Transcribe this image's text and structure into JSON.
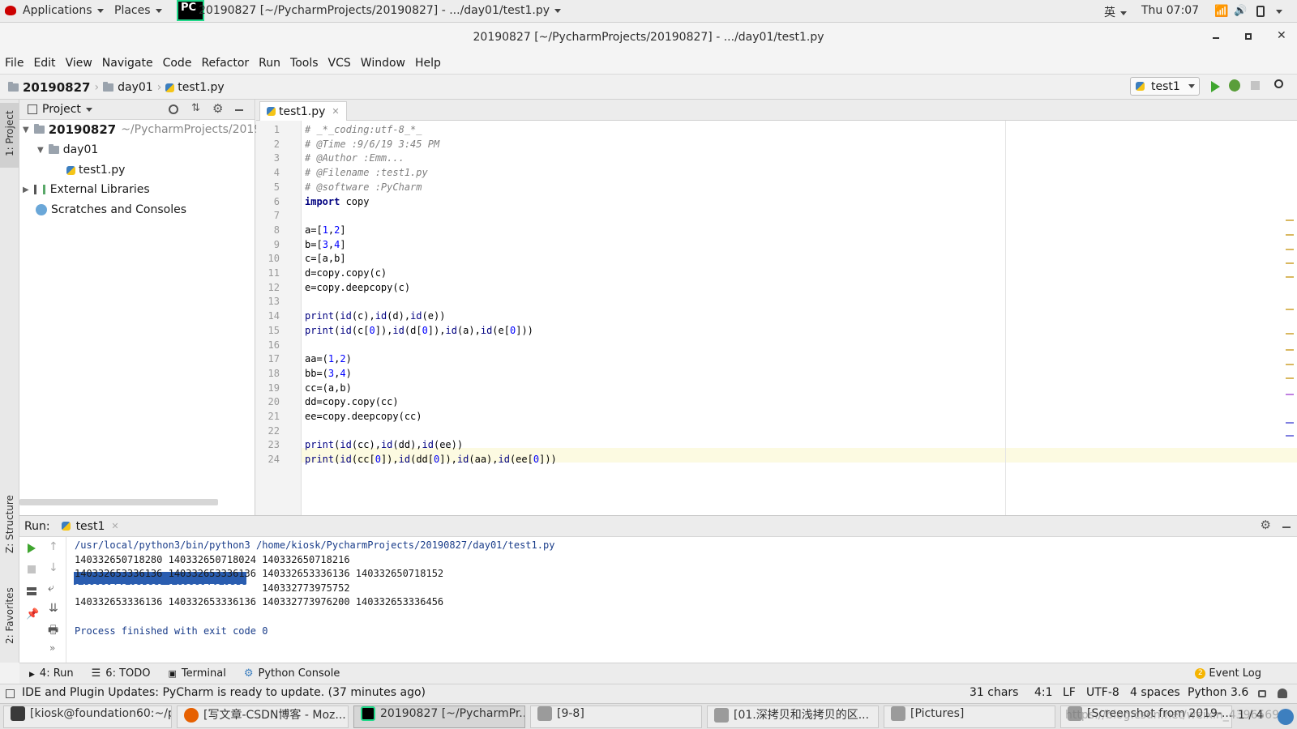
{
  "gnome": {
    "applications": "Applications",
    "places": "Places",
    "window_title": "20190827 [~/PycharmProjects/20190827] - .../day01/test1.py",
    "lang": "英",
    "clock": "Thu 07:07"
  },
  "window": {
    "title": "20190827 [~/PycharmProjects/20190827] - .../day01/test1.py"
  },
  "menu": [
    "File",
    "Edit",
    "View",
    "Navigate",
    "Code",
    "Refactor",
    "Run",
    "Tools",
    "VCS",
    "Window",
    "Help"
  ],
  "breadcrumb": [
    "20190827",
    "day01",
    "test1.py"
  ],
  "run_config": "test1",
  "project": {
    "header": "Project",
    "root": {
      "name": "20190827",
      "path": "~/PycharmProjects/2019"
    },
    "folder": "day01",
    "file": "test1.py",
    "external": "External Libraries",
    "scratches": "Scratches and Consoles"
  },
  "sidebar_tabs": {
    "project": "1: Project",
    "structure": "Z: Structure",
    "favorites": "2: Favorites"
  },
  "editor": {
    "tab": "test1.py",
    "lines": [
      "# _*_coding:utf-8_*_",
      "# @Time :9/6/19 3:45 PM",
      "# @Author :Emm...",
      "# @Filename :test1.py",
      "# @software :PyCharm",
      "import copy",
      "",
      "a=[1,2]",
      "b=[3,4]",
      "c=[a,b]",
      "d=copy.copy(c)",
      "e=copy.deepcopy(c)",
      "",
      "print(id(c),id(d),id(e))",
      "print(id(c[0]),id(d[0]),id(a),id(e[0]))",
      "",
      "aa=(1,2)",
      "bb=(3,4)",
      "cc=(a,b)",
      "dd=copy.copy(cc)",
      "ee=copy.deepcopy(cc)",
      "",
      "print(id(cc),id(dd),id(ee))",
      "print(id(cc[0]),id(dd[0]),id(aa),id(ee[0]))"
    ]
  },
  "run": {
    "label": "Run:",
    "tab": "test1",
    "output": [
      "/usr/local/python3/bin/python3 /home/kiosk/PycharmProjects/20190827/day01/test1.py",
      "140332650718280 140332650718024 140332650718216",
      "140332653336136 140332653336136 140332653336136 140332650718152",
      "140332773431880 140332773431880 140332773975752",
      "140332653336136 140332653336136 140332773976200 140332653336456",
      "",
      "Process finished with exit code 0"
    ]
  },
  "bottom_tabs": [
    "4: Run",
    "6: TODO",
    "Terminal",
    "Python Console"
  ],
  "event_log": {
    "count": "2",
    "label": "Event Log"
  },
  "status": {
    "message": "IDE and Plugin Updates: PyCharm is ready to update. (37 minutes ago)",
    "chars": "31 chars",
    "pos": "4:1",
    "le": "LF",
    "enc": "UTF-8",
    "indent": "4 spaces",
    "interp": "Python 3.6"
  },
  "taskbar": [
    {
      "label": "[kiosk@foundation60:~/p...",
      "color": "#3a3a3a"
    },
    {
      "label": "[写文章-CSDN博客 - Moz...",
      "color": "#e66000"
    },
    {
      "label": "20190827 [~/PycharmPr...",
      "color": "#21d789"
    },
    {
      "label": "[9-8]",
      "color": "#9b9b9b"
    },
    {
      "label": "[01.深拷贝和浅拷贝的区...",
      "color": "#9b9b9b"
    },
    {
      "label": "[Pictures]",
      "color": "#9b9b9b"
    },
    {
      "label": "[Screenshot from 2019-...",
      "color": "#9b9b9b"
    }
  ],
  "workspace": "1 / 4",
  "watermark": "https://blog.csdn.net/weixin_4396569"
}
